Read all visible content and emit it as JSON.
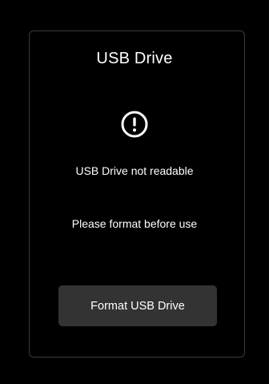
{
  "dialog": {
    "title": "USB Drive",
    "icon": "alert-circle-icon",
    "message": "USB Drive not readable",
    "instruction": "Please format before use",
    "format_button_label": "Format USB Drive"
  },
  "colors": {
    "background": "#000000",
    "panel_border": "#3a3a3a",
    "button_bg": "#333333",
    "text": "#ffffff"
  }
}
